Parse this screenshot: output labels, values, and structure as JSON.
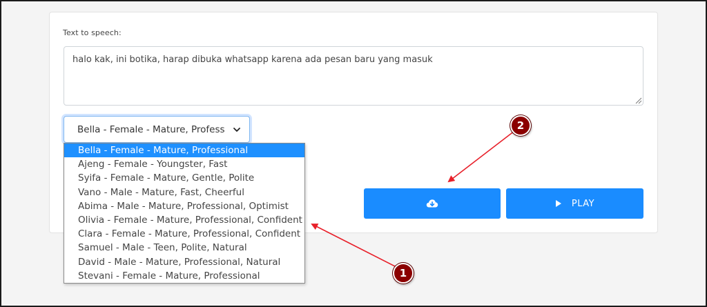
{
  "form": {
    "tts_label": "Text to speech:",
    "text_value": "halo kak, ini botika, harap dibuka whatsapp karena ada pesan baru yang masuk",
    "voice_selected": "Bella - Female - Mature, Profess"
  },
  "voice_options": [
    "Bella - Female - Mature, Professional",
    "Ajeng - Female - Youngster, Fast",
    "Syifa - Female - Mature, Gentle, Polite",
    "Vano - Male - Mature, Fast, Cheerful",
    "Abima - Male - Mature, Professional, Optimist",
    "Olivia - Female - Mature, Professional, Confident",
    "Clara - Female - Mature, Professional, Confident",
    "Samuel - Male - Teen, Polite, Natural",
    "David - Male - Mature, Professional, Natural",
    "Stevani - Female - Mature, Professional"
  ],
  "buttons": {
    "download_icon": "cloud-download-icon",
    "play_icon": "play-icon",
    "play_label": "PLAY"
  },
  "annotations": {
    "badge1": "1",
    "badge2": "2"
  },
  "colors": {
    "accent": "#1a8cff",
    "selected_option": "#1e90ff",
    "annotation": "#8b0000",
    "arrow": "#e8202a"
  }
}
